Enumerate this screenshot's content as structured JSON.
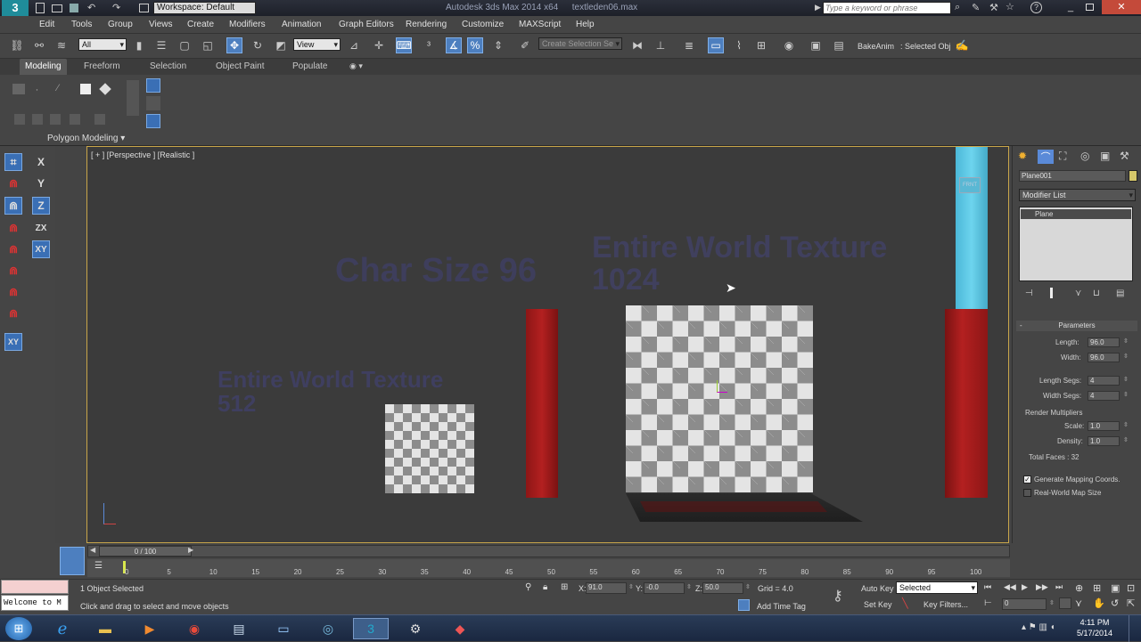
{
  "titlebar": {
    "workspace": "Workspace: Default",
    "app_title": "Autodesk 3ds Max  2014 x64",
    "file_name": "textleden06.max",
    "search_placeholder": "Type a keyword or phrase"
  },
  "menu": [
    "Edit",
    "Tools",
    "Group",
    "Views",
    "Create",
    "Modifiers",
    "Animation",
    "Graph Editors",
    "Rendering",
    "Customize",
    "MAXScript",
    "Help"
  ],
  "toolbar": {
    "selection_filter": "All",
    "ref_coord": "View",
    "named_selection": "Create Selection Se",
    "bake_anim": "BakeAnim",
    "selected_obj": ": Selected Obj"
  },
  "ribbon": {
    "tabs": [
      "Modeling",
      "Freeform",
      "Selection",
      "Object Paint",
      "Populate"
    ],
    "panel_label": "Polygon Modeling"
  },
  "axis_buttons": [
    "X",
    "Y",
    "Z",
    "ZX",
    "XY"
  ],
  "viewport": {
    "label": "[ + ] [Perspective ] [Realistic ]",
    "text_char_size": "Char Size 96",
    "text_world_1024": "Entire World Texture\n1024",
    "text_world_512": "Entire World Texture\n512"
  },
  "command_panel": {
    "object_name": "Plane001",
    "modifier_list": "Modifier List",
    "stack_item": "Plane",
    "rollout_title": "Parameters",
    "length_label": "Length:",
    "length_value": "96.0",
    "width_label": "Width:",
    "width_value": "96.0",
    "length_segs_label": "Length Segs:",
    "length_segs_value": "4",
    "width_segs_label": "Width Segs:",
    "width_segs_value": "4",
    "render_mult_label": "Render Multipliers",
    "scale_label": "Scale:",
    "scale_value": "1.0",
    "density_label": "Density:",
    "density_value": "1.0",
    "total_faces": "Total Faces : 32",
    "gen_mapping": "Generate Mapping Coords.",
    "gen_mapping_checked": true,
    "real_world": "Real-World Map Size",
    "real_world_checked": false
  },
  "timeline": {
    "frame_counter": "0 / 100",
    "ticks": [
      "0",
      "5",
      "10",
      "15",
      "20",
      "25",
      "30",
      "35",
      "40",
      "45",
      "50",
      "55",
      "60",
      "65",
      "70",
      "75",
      "80",
      "85",
      "90",
      "95",
      "100"
    ]
  },
  "status": {
    "maxscript_listener": "Welcome to M",
    "objects_selected": "1 Object Selected",
    "prompt": "Click and drag to select and move objects",
    "x_label": "X:",
    "x_value": "91.0",
    "y_label": "Y:",
    "y_value": "-0.0",
    "z_label": "Z:",
    "z_value": "50.0",
    "grid": "Grid = 4.0",
    "add_time_tag": "Add Time Tag",
    "auto_key": "Auto Key",
    "set_key": "Set Key",
    "key_mode": "Selected",
    "key_filters": "Key Filters...",
    "current_frame": "0"
  },
  "taskbar": {
    "time": "4:11 PM",
    "date": "5/17/2014"
  },
  "colors": {
    "viewport_border": "#c9a64a",
    "active_blue": "#3a6fb5",
    "red_box": "#a61c1c",
    "cyan_box": "#5cc8e6"
  }
}
